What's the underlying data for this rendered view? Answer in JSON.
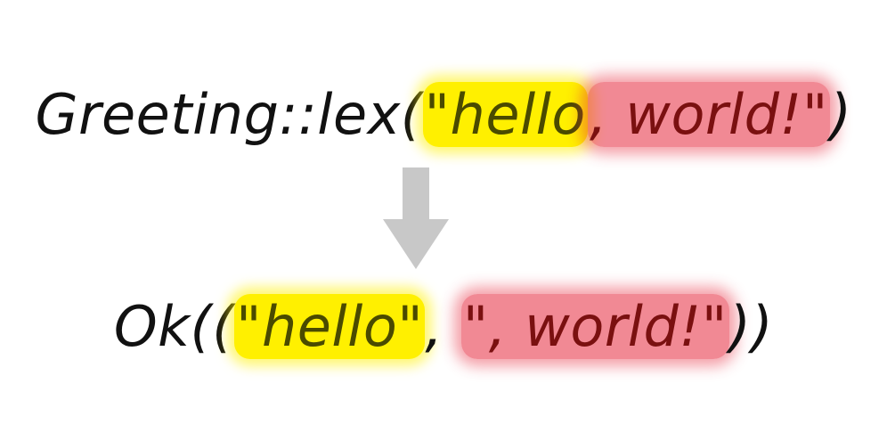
{
  "top": {
    "prefix": "Greeting::lex(",
    "hello": "\"hello",
    "rest": ", world!\"",
    "suffix": ")"
  },
  "arrow": {
    "icon": "arrow-down-icon",
    "color": "#c8c8c8"
  },
  "bottom": {
    "prefix": "Ok((",
    "hello": "\"hello\"",
    "sep": ", ",
    "rest": "\", world!\"",
    "suffix": "))"
  },
  "colors": {
    "yellow_highlight": "#fff000",
    "red_highlight": "#e6283c",
    "red_text": "#7a1010",
    "yellow_text": "#4a4a00"
  }
}
